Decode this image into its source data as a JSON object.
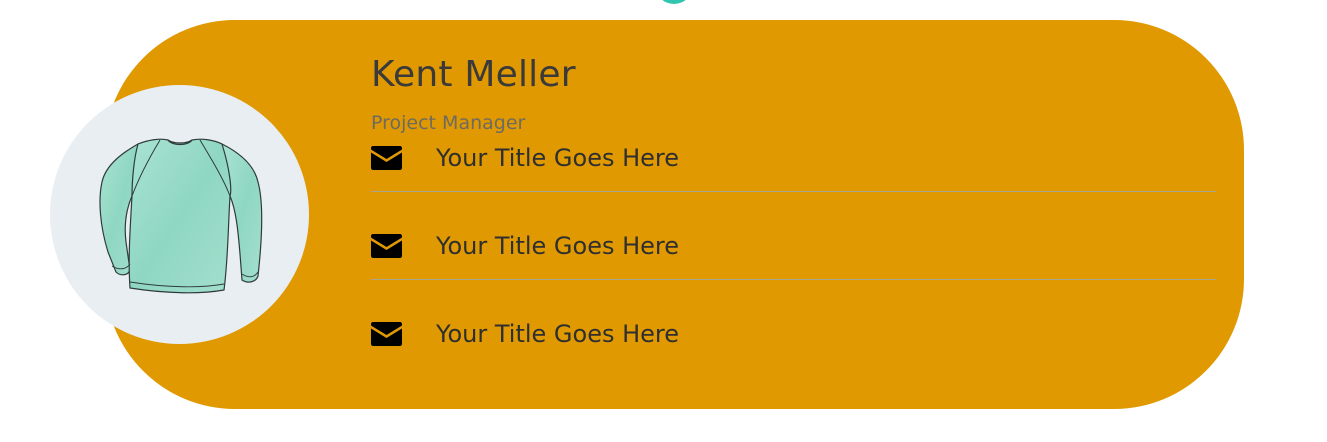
{
  "profile": {
    "name": "Kent Meller",
    "role": "Project Manager",
    "image_icon": "sweater-illustration"
  },
  "contacts": [
    {
      "icon": "envelope-icon",
      "label": "Your Title Goes Here"
    },
    {
      "icon": "envelope-icon",
      "label": "Your Title Goes Here"
    },
    {
      "icon": "envelope-icon",
      "label": "Your Title Goes Here"
    }
  ],
  "colors": {
    "card_background": "#e09900",
    "avatar_background": "#e9eef3",
    "accent_dot": "#2fc5b0",
    "divider": "#a6a78a"
  }
}
